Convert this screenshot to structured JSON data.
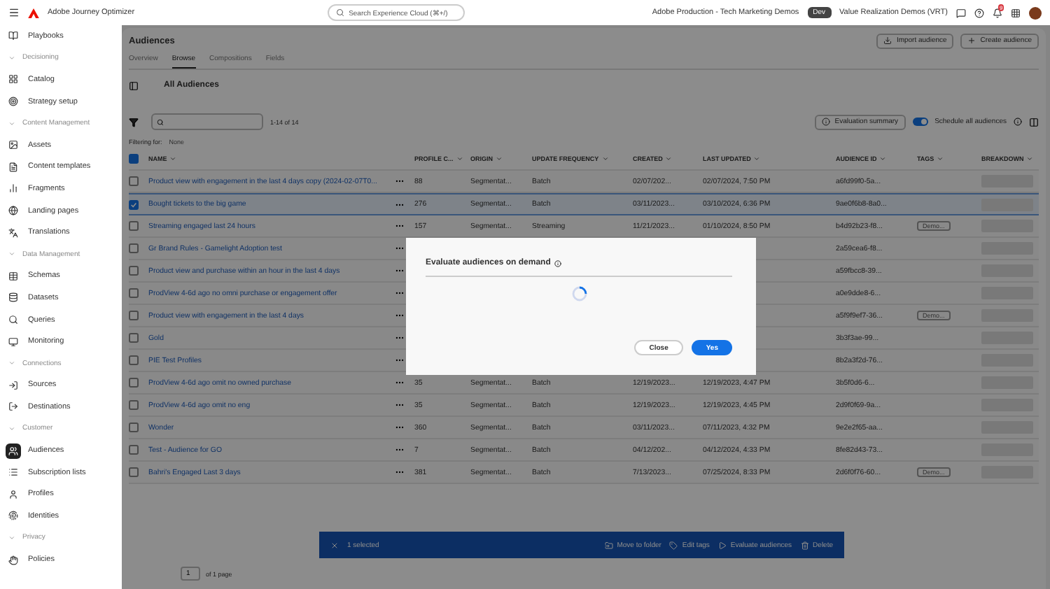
{
  "app_bar": {
    "product": "Adobe Journey Optimizer",
    "search_placeholder": "Search Experience Cloud (⌘+/)",
    "org": "Adobe Production - Tech Marketing Demos",
    "env_badge": "Dev",
    "sandbox": "Value Realization Demos (VRT)",
    "notification_count": "9"
  },
  "sidebar": [
    {
      "kind": "item",
      "label": "Playbooks",
      "selected": false
    },
    {
      "kind": "section",
      "label": "Decisioning"
    },
    {
      "kind": "item",
      "label": "Catalog",
      "selected": false
    },
    {
      "kind": "item",
      "label": "Strategy setup",
      "selected": false
    },
    {
      "kind": "section",
      "label": "Content Management"
    },
    {
      "kind": "item",
      "label": "Assets",
      "selected": false
    },
    {
      "kind": "item",
      "label": "Content templates",
      "selected": false
    },
    {
      "kind": "item",
      "label": "Fragments",
      "selected": false
    },
    {
      "kind": "item",
      "label": "Landing pages",
      "selected": false
    },
    {
      "kind": "item",
      "label": "Translations",
      "selected": false
    },
    {
      "kind": "section",
      "label": "Data Management"
    },
    {
      "kind": "item",
      "label": "Schemas",
      "selected": false
    },
    {
      "kind": "item",
      "label": "Datasets",
      "selected": false
    },
    {
      "kind": "item",
      "label": "Queries",
      "selected": false
    },
    {
      "kind": "item",
      "label": "Monitoring",
      "selected": false
    },
    {
      "kind": "section",
      "label": "Connections"
    },
    {
      "kind": "item",
      "label": "Sources",
      "selected": false
    },
    {
      "kind": "item",
      "label": "Destinations",
      "selected": false
    },
    {
      "kind": "section",
      "label": "Customer"
    },
    {
      "kind": "item",
      "label": "Audiences",
      "selected": true
    },
    {
      "kind": "item",
      "label": "Subscription lists",
      "selected": false
    },
    {
      "kind": "item",
      "label": "Profiles",
      "selected": false
    },
    {
      "kind": "item",
      "label": "Identities",
      "selected": false
    },
    {
      "kind": "section",
      "label": "Privacy"
    },
    {
      "kind": "item",
      "label": "Policies",
      "selected": false
    }
  ],
  "page": {
    "title": "Audiences",
    "tabs": [
      {
        "label": "Overview",
        "selected": false
      },
      {
        "label": "Browse",
        "selected": true
      },
      {
        "label": "Compositions",
        "selected": false
      },
      {
        "label": "Fields",
        "selected": false
      }
    ],
    "buttons": [
      "Import audience",
      "Create audience"
    ],
    "folder_title": "All Audiences",
    "count": "1-14 of 14",
    "filter_label": "Filtering for:",
    "filter_value": "None",
    "evaluation_button": "Evaluation summary",
    "schedule_toggle": {
      "label": "Schedule all audiences",
      "on": true
    }
  },
  "table": {
    "columns": [
      "NAME",
      "PROFILE C...",
      "ORIGIN",
      "UPDATE FREQUENCY",
      "CREATED",
      "LAST UPDATED",
      "AUDIENCE ID",
      "TAGS",
      "BREAKDOWN"
    ],
    "all_selected": true,
    "rows": [
      {
        "name": "Product view with engagement in the last 4 days copy (2024-02-07T0...",
        "selected": false,
        "profiles": "88",
        "origin": "Segmentat...",
        "frequency": "Batch",
        "created": "02/07/202...",
        "updated": "02/07/2024, 7:50 PM",
        "id": "a6fd99f0-5a..."
      },
      {
        "name": "Bought tickets to the big game",
        "selected": true,
        "profiles": "276",
        "origin": "Segmentat...",
        "frequency": "Batch",
        "created": "03/11/2023...",
        "updated": "03/10/2024, 6:36 PM",
        "id": "9ae0f6b8-8a0..."
      },
      {
        "name": "Streaming engaged last 24 hours",
        "selected": false,
        "profiles": "157",
        "origin": "Segmentat...",
        "frequency": "Streaming",
        "created": "11/21/2023...",
        "updated": "01/10/2024, 8:50 PM",
        "id": "b4d92b23-f8...",
        "tag": "Demo..."
      },
      {
        "name": "Gr Brand Rules - Gamelight Adoption test",
        "selected": false,
        "id": "2a59cea6-f8..."
      },
      {
        "name": "Product view and purchase within an hour in the last 4 days",
        "selected": false,
        "id": "a59fbcc8-39..."
      },
      {
        "name": "ProdView 4-6d ago no omni purchase or engagement offer",
        "selected": false,
        "id": "a0e9dde8-6..."
      },
      {
        "name": "Product view with engagement in the last 4 days",
        "selected": false,
        "id": "a5f9f9ef7-36...",
        "tag": "Demo..."
      },
      {
        "name": "Gold",
        "selected": false,
        "id": "3b3f3ae-99..."
      },
      {
        "name": "PIE Test Profiles",
        "selected": false,
        "id": "8b2a3f2d-76..."
      },
      {
        "name": "ProdView 4-6d ago omit no owned purchase",
        "selected": false,
        "profiles": "35",
        "origin": "Segmentat...",
        "frequency": "Batch",
        "created": "12/19/2023...",
        "updated": "12/19/2023, 4:47 PM",
        "id": "3b5f0d6-6..."
      },
      {
        "name": "ProdView 4-6d ago omit no eng",
        "selected": false,
        "profiles": "35",
        "origin": "Segmentat...",
        "frequency": "Batch",
        "created": "12/19/2023...",
        "updated": "12/19/2023, 4:45 PM",
        "id": "2d9f0f69-9a..."
      },
      {
        "name": "Wonder",
        "selected": false,
        "profiles": "360",
        "origin": "Segmentat...",
        "frequency": "Batch",
        "created": "03/11/2023...",
        "updated": "07/11/2023, 4:32 PM",
        "id": "9e2e2f65-aa..."
      },
      {
        "name": "Test - Audience for GO",
        "selected": false,
        "profiles": "7",
        "origin": "Segmentat...",
        "frequency": "Batch",
        "created": "04/12/202...",
        "updated": "04/12/2024, 4:33 PM",
        "id": "8fe82d43-73..."
      },
      {
        "name": "Bahri's Engaged Last 3 days",
        "selected": false,
        "profiles": "381",
        "origin": "Segmentat...",
        "frequency": "Batch",
        "created": "7/13/2023...",
        "updated": "07/25/2024, 8:33 PM",
        "id": "2d6f0f76-60...",
        "tag": "Demo..."
      }
    ]
  },
  "action_bar": {
    "selected_count": "1 selected",
    "actions": [
      {
        "kind": "move",
        "label": "Move to folder"
      },
      {
        "kind": "tags",
        "label": "Edit tags"
      },
      {
        "kind": "evaluate",
        "label": "Evaluate audiences"
      },
      {
        "kind": "delete",
        "label": "Delete"
      }
    ]
  },
  "pagination": {
    "page": "1",
    "total": "of 1 page"
  },
  "dialog": {
    "title": "Evaluate audiences on demand",
    "loading": true,
    "buttons": [
      {
        "label": "Close",
        "primary": false
      },
      {
        "label": "Yes",
        "primary": true
      }
    ]
  }
}
